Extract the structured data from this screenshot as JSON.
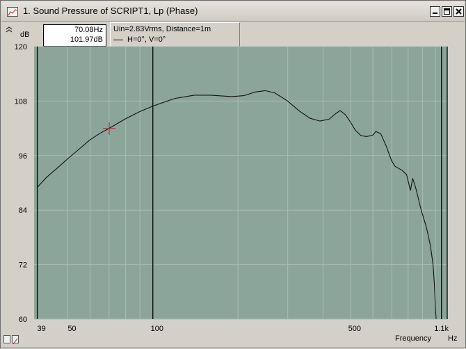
{
  "window": {
    "title": "1. Sound Pressure of SCRIPT1, Lp (Phase)",
    "buttons": {
      "minimize": "_",
      "maximize": "□",
      "close": "×"
    }
  },
  "cursor_readout": {
    "frequency": "70.08Hz",
    "level": "101.97dB"
  },
  "legend": {
    "line1": "Uin=2.83Vrms, Distance=1m",
    "line2": "H=0°, V=0°"
  },
  "axes": {
    "y_unit": "dB",
    "x_unit": "Hz",
    "x_title": "Frequency"
  },
  "colors": {
    "plot_bg": "#8ca59a",
    "grid": "#a9bcb4",
    "curve": "#111111",
    "window_bg": "#d4d0c8"
  },
  "chart_data": {
    "type": "line",
    "x_scale": "log",
    "xlim": [
      38,
      1100
    ],
    "ylim": [
      60,
      120
    ],
    "y_ticks": [
      {
        "value": 120,
        "label": "120"
      },
      {
        "value": 108,
        "label": "108"
      },
      {
        "value": 96,
        "label": "96"
      },
      {
        "value": 84,
        "label": "84"
      },
      {
        "value": 72,
        "label": "72"
      },
      {
        "value": 60,
        "label": "60"
      }
    ],
    "x_ticks": [
      {
        "value": 39,
        "label": "39"
      },
      {
        "value": 50,
        "label": "50"
      },
      {
        "value": 100,
        "label": "100"
      },
      {
        "value": 500,
        "label": "500"
      },
      {
        "value": 1100,
        "label": "1.1k"
      }
    ],
    "x_grid": [
      39,
      50,
      60,
      70,
      80,
      90,
      100,
      200,
      300,
      400,
      500,
      600,
      700,
      800,
      900,
      1000,
      1100
    ],
    "vertical_markers": [
      39,
      100,
      1050,
      1100
    ],
    "cursor": {
      "x": 70.08,
      "y": 101.97
    },
    "series": [
      {
        "points": [
          [
            39,
            89.0
          ],
          [
            42,
            91.2
          ],
          [
            46,
            93.3
          ],
          [
            50,
            95.3
          ],
          [
            55,
            97.5
          ],
          [
            60,
            99.5
          ],
          [
            65,
            100.9
          ],
          [
            70,
            102.0
          ],
          [
            80,
            104.1
          ],
          [
            90,
            105.7
          ],
          [
            100,
            106.9
          ],
          [
            110,
            107.8
          ],
          [
            120,
            108.6
          ],
          [
            140,
            109.3
          ],
          [
            160,
            109.3
          ],
          [
            190,
            109.0
          ],
          [
            210,
            109.2
          ],
          [
            230,
            110.0
          ],
          [
            250,
            110.3
          ],
          [
            270,
            109.8
          ],
          [
            300,
            108.0
          ],
          [
            330,
            105.8
          ],
          [
            360,
            104.2
          ],
          [
            390,
            103.6
          ],
          [
            420,
            104.0
          ],
          [
            445,
            105.3
          ],
          [
            460,
            105.9
          ],
          [
            480,
            105.0
          ],
          [
            500,
            103.4
          ],
          [
            520,
            101.6
          ],
          [
            545,
            100.4
          ],
          [
            570,
            100.2
          ],
          [
            600,
            100.5
          ],
          [
            615,
            101.3
          ],
          [
            640,
            100.8
          ],
          [
            670,
            98.0
          ],
          [
            700,
            94.8
          ],
          [
            720,
            93.6
          ],
          [
            760,
            92.8
          ],
          [
            790,
            91.8
          ],
          [
            815,
            88.3
          ],
          [
            830,
            91.0
          ],
          [
            850,
            89.0
          ],
          [
            890,
            84.0
          ],
          [
            930,
            80.0
          ],
          [
            960,
            76.0
          ],
          [
            980,
            72.0
          ],
          [
            990,
            68.0
          ],
          [
            1000,
            62.0
          ],
          [
            1005,
            60.0
          ]
        ]
      }
    ]
  }
}
